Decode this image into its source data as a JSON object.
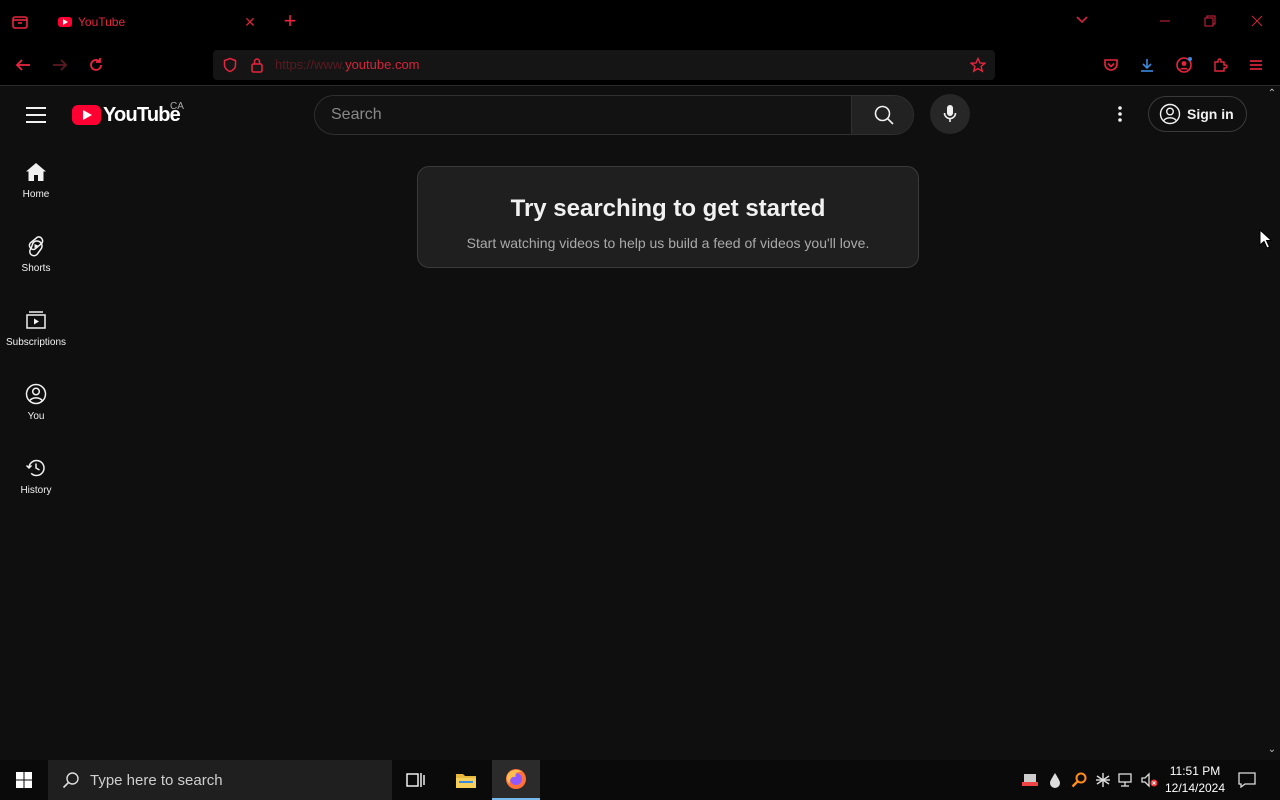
{
  "browser": {
    "tab": {
      "title": "YouTube"
    },
    "url": {
      "prefix": "https://www.",
      "domain": "youtube.com"
    }
  },
  "youtube": {
    "logo_text": "YouTube",
    "country_code": "CA",
    "search_placeholder": "Search",
    "signin_label": "Sign in",
    "guide": [
      {
        "label": "Home"
      },
      {
        "label": "Shorts"
      },
      {
        "label": "Subscriptions"
      },
      {
        "label": "You"
      },
      {
        "label": "History"
      }
    ],
    "prompt": {
      "title": "Try searching to get started",
      "subtitle": "Start watching videos to help us build a feed of videos you'll love."
    }
  },
  "taskbar": {
    "search_placeholder": "Type here to search",
    "time": "11:51 PM",
    "date": "12/14/2024"
  },
  "colors": {
    "accent_red": "#ff0033",
    "browser_icon_red": "#e8253f",
    "page_bg": "#0f0f0f"
  }
}
